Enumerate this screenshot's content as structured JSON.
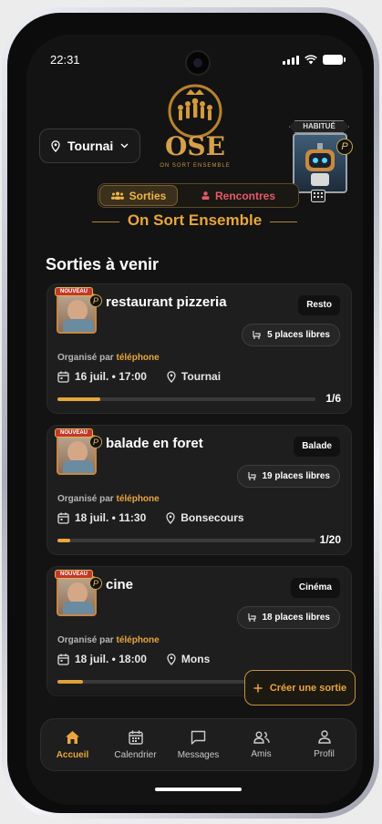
{
  "status": {
    "time": "22:31"
  },
  "header": {
    "city": "Tournai",
    "logo_text": "OSE",
    "logo_subtitle": "ON SORT ENSEMBLE",
    "badge_label": "HABITUÉ"
  },
  "tabs": [
    {
      "label": "Sorties",
      "active": true
    },
    {
      "label": "Rencontres",
      "active": false
    }
  ],
  "app_title": "On Sort Ensemble",
  "section_title": "Sorties à venir",
  "events": [
    {
      "ribbon": "NOUVEAU",
      "title": "restaurant pizzeria",
      "tag": "Resto",
      "places": "5 places libres",
      "organizer_prefix": "Organisé par",
      "organizer": "téléphone",
      "date": "16 juil. • 17:00",
      "location": "Tournai",
      "count": "1/6",
      "progress": 0.167
    },
    {
      "ribbon": "NOUVEAU",
      "title": "balade en foret",
      "tag": "Balade",
      "places": "19 places libres",
      "organizer_prefix": "Organisé par",
      "organizer": "téléphone",
      "date": "18 juil. • 11:30",
      "location": "Bonsecours",
      "count": "1/20",
      "progress": 0.05
    },
    {
      "ribbon": "NOUVEAU",
      "title": "cine",
      "tag": "Cinéma",
      "places": "18 places libres",
      "organizer_prefix": "Organisé par",
      "organizer": "téléphone",
      "date": "18 juil. • 18:00",
      "location": "Mons",
      "count": "",
      "progress": 0.1
    }
  ],
  "fab_label": "Créer une sortie",
  "nav": [
    {
      "label": "Accueil",
      "icon": "home-icon",
      "active": true
    },
    {
      "label": "Calendrier",
      "icon": "calendar-icon",
      "active": false
    },
    {
      "label": "Messages",
      "icon": "message-icon",
      "active": false
    },
    {
      "label": "Amis",
      "icon": "friends-icon",
      "active": false
    },
    {
      "label": "Profil",
      "icon": "profile-icon",
      "active": false
    }
  ],
  "colors": {
    "accent": "#e8a63c",
    "secondary": "#e45a6a",
    "background": "#131313"
  }
}
